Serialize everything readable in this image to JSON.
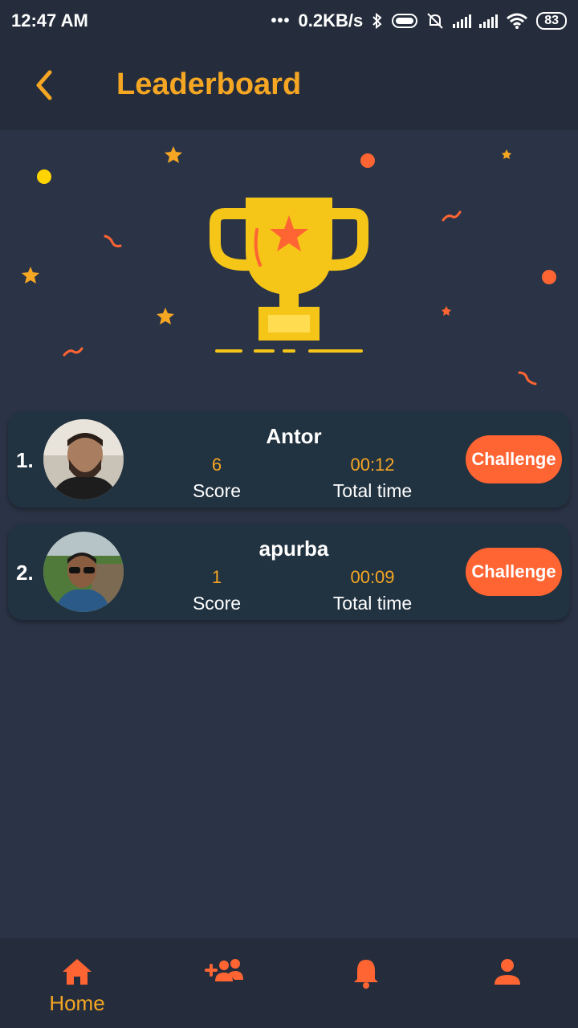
{
  "status_bar": {
    "time": "12:47 AM",
    "dots": "•••",
    "network_speed": "0.2KB/s",
    "battery": "83",
    "icons": [
      "bluetooth-icon",
      "toggle-icon",
      "silent-icon",
      "signal-icon",
      "signal-icon",
      "wifi-icon",
      "battery-icon"
    ]
  },
  "header": {
    "title": "Leaderboard",
    "back_icon": "chevron-left-icon"
  },
  "colors": {
    "accent": "#f5a623",
    "challenge": "#ff6433",
    "background": "#2b3446",
    "bar": "#252d3c",
    "card": "#213240"
  },
  "leaderboard": [
    {
      "rank": "1.",
      "name": "Antor",
      "score": "6",
      "score_label": "Score",
      "time": "00:12",
      "time_label": "Total time",
      "button": "Challenge"
    },
    {
      "rank": "2.",
      "name": "apurba",
      "score": "1",
      "score_label": "Score",
      "time": "00:09",
      "time_label": "Total time",
      "button": "Challenge"
    }
  ],
  "bottom_nav": {
    "items": [
      {
        "icon": "home-icon",
        "label": "Home",
        "active": true
      },
      {
        "icon": "add-friends-icon",
        "label": ""
      },
      {
        "icon": "bell-icon",
        "label": ""
      },
      {
        "icon": "profile-icon",
        "label": ""
      }
    ]
  }
}
